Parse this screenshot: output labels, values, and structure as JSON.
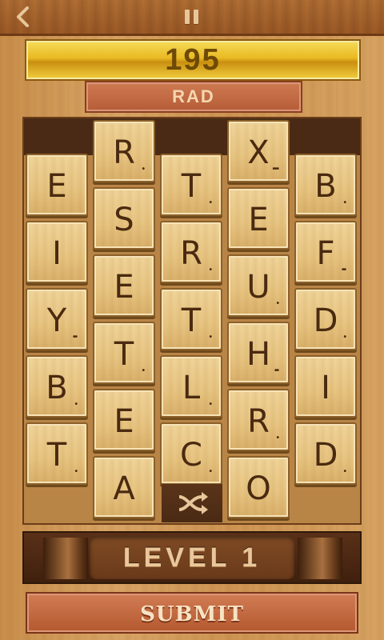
{
  "header": {
    "back_icon": "chevron-left-icon",
    "pause_icon": "pause-icon"
  },
  "score": "195",
  "current_word": "RAD",
  "board": {
    "columns": [
      [
        {
          "letter": "E",
          "dots": ""
        },
        {
          "letter": "I",
          "dots": ""
        },
        {
          "letter": "Y",
          "dots": "••"
        },
        {
          "letter": "B",
          "dots": "•"
        },
        {
          "letter": "T",
          "dots": "•"
        }
      ],
      [
        {
          "letter": "R",
          "dots": "•"
        },
        {
          "letter": "S",
          "dots": ""
        },
        {
          "letter": "E",
          "dots": ""
        },
        {
          "letter": "T",
          "dots": "•"
        },
        {
          "letter": "E",
          "dots": ""
        },
        {
          "letter": "A",
          "dots": ""
        }
      ],
      [
        {
          "letter": "T",
          "dots": "•"
        },
        {
          "letter": "R",
          "dots": "•"
        },
        {
          "letter": "T",
          "dots": "•"
        },
        {
          "letter": "L",
          "dots": "•"
        },
        {
          "letter": "C",
          "dots": "•"
        }
      ],
      [
        {
          "letter": "X",
          "dots": "•••"
        },
        {
          "letter": "E",
          "dots": ""
        },
        {
          "letter": "U",
          "dots": "•"
        },
        {
          "letter": "H",
          "dots": "••"
        },
        {
          "letter": "R",
          "dots": "•"
        },
        {
          "letter": "O",
          "dots": ""
        }
      ],
      [
        {
          "letter": "B",
          "dots": "•"
        },
        {
          "letter": "F",
          "dots": "••"
        },
        {
          "letter": "D",
          "dots": "•"
        },
        {
          "letter": "I",
          "dots": ""
        },
        {
          "letter": "D",
          "dots": "•"
        }
      ]
    ],
    "shuffle_icon": "shuffle-icon"
  },
  "level_label": "LEVEL 1",
  "submit_label": "SUBMIT"
}
